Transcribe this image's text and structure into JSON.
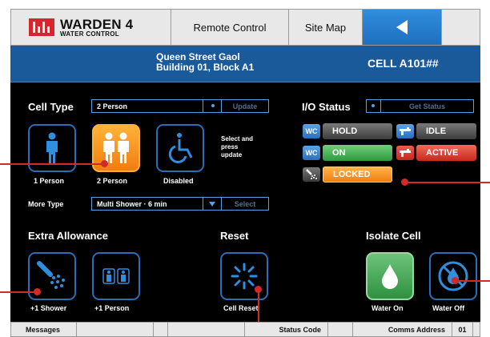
{
  "topbar": {
    "logo_line1": "WARDEN 4",
    "logo_line2": "WATER CONTROL",
    "remote_label": "Remote Control",
    "sitemap_label": "Site Map",
    "back_icon": "back-arrow-icon"
  },
  "header": {
    "location_line1": "Queen Street Gaol",
    "location_line2": "Building 01, Block A1",
    "cell_id": "CELL A101##"
  },
  "cell_type": {
    "title": "Cell Type",
    "selected_value": "2 Person",
    "update_label": "Update",
    "options": [
      {
        "label": "1 Person",
        "icon": "person-icon",
        "selected": false
      },
      {
        "label": "2 Person",
        "icon": "two-person-icon",
        "selected": true
      },
      {
        "label": "Disabled",
        "icon": "wheelchair-icon",
        "selected": false
      }
    ],
    "hint": [
      "Select and",
      "press",
      "update"
    ],
    "more_type_label": "More Type",
    "more_type_value": "Multi Shower · 6 min",
    "select_label": "Select"
  },
  "io_status": {
    "title": "I/O Status",
    "get_status_label": "Get Status",
    "items": [
      {
        "icon_text": "WC",
        "label": "HOLD",
        "color": "#555555"
      },
      {
        "icon_text": "",
        "label": "IDLE",
        "color": "#555555",
        "icon": "tap-icon"
      },
      {
        "icon_text": "WC",
        "label": "ON",
        "color": "#3aa34a"
      },
      {
        "icon_text": "",
        "label": "ACTIVE",
        "color": "#d0352a",
        "icon": "tap-icon"
      },
      {
        "icon_text": "",
        "label": "LOCKED",
        "color": "#f08a1a",
        "icon": "shower-icon"
      }
    ]
  },
  "extra_allowance": {
    "title": "Extra Allowance",
    "shower_label": "+1 Shower",
    "person_label": "+1 Person"
  },
  "reset": {
    "title": "Reset",
    "cell_reset_label": "Cell Reset"
  },
  "isolate": {
    "title": "Isolate Cell",
    "water_on_label": "Water On",
    "water_off_label": "Water Off"
  },
  "statusbar": {
    "messages_label": "Messages",
    "status_code_label": "Status Code",
    "comms_address_label": "Comms Address",
    "comms_address_value": "01"
  },
  "colors": {
    "header_blue": "#1b5a9a",
    "accent_blue": "#2f8ede",
    "selected_orange": "#f59a20",
    "water_on_green": "#3f9c4f",
    "callout_red": "#d22a2a"
  }
}
